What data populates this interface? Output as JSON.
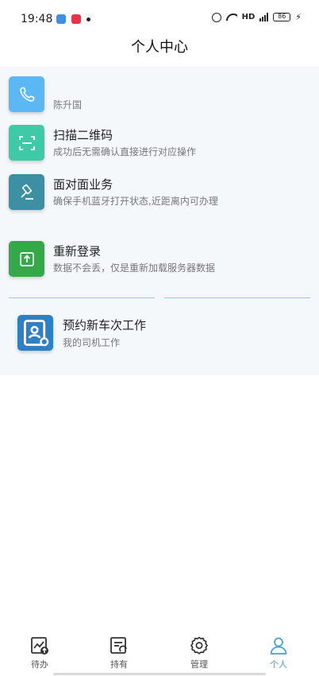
{
  "status_bar": {
    "time": "19:48",
    "network": "HD",
    "battery": "86"
  },
  "header": {
    "title": "个人中心"
  },
  "menu": {
    "items": [
      {
        "title": "",
        "subtitle": "陈升国",
        "icon": "phone-icon",
        "color": "#5bb8f5"
      },
      {
        "title": "扫描二维码",
        "subtitle": "成功后无需确认直接进行对应操作",
        "icon": "scan-icon",
        "color": "#3ec9a7"
      },
      {
        "title": "面对面业务",
        "subtitle": "确保手机蓝牙打开状态,近距离内可办理",
        "icon": "gavel-icon",
        "color": "#3d8fa3"
      },
      {
        "title": "重新登录",
        "subtitle": "数据不会丢，仅是重新加载服务器数据",
        "icon": "upload-icon",
        "color": "#35a84a"
      }
    ]
  },
  "reserve": {
    "title": "预约新车次工作",
    "subtitle": "我的司机工作",
    "icon": "driver-card-icon",
    "color": "#2e7fc3"
  },
  "bottom_nav": {
    "active_color": "#4a9fd6",
    "items": [
      {
        "label": "待办",
        "icon": "todo-chart-icon"
      },
      {
        "label": "持有",
        "icon": "hold-list-icon"
      },
      {
        "label": "管理",
        "icon": "gear-icon"
      },
      {
        "label": "个人",
        "icon": "person-icon",
        "active": true
      }
    ]
  }
}
